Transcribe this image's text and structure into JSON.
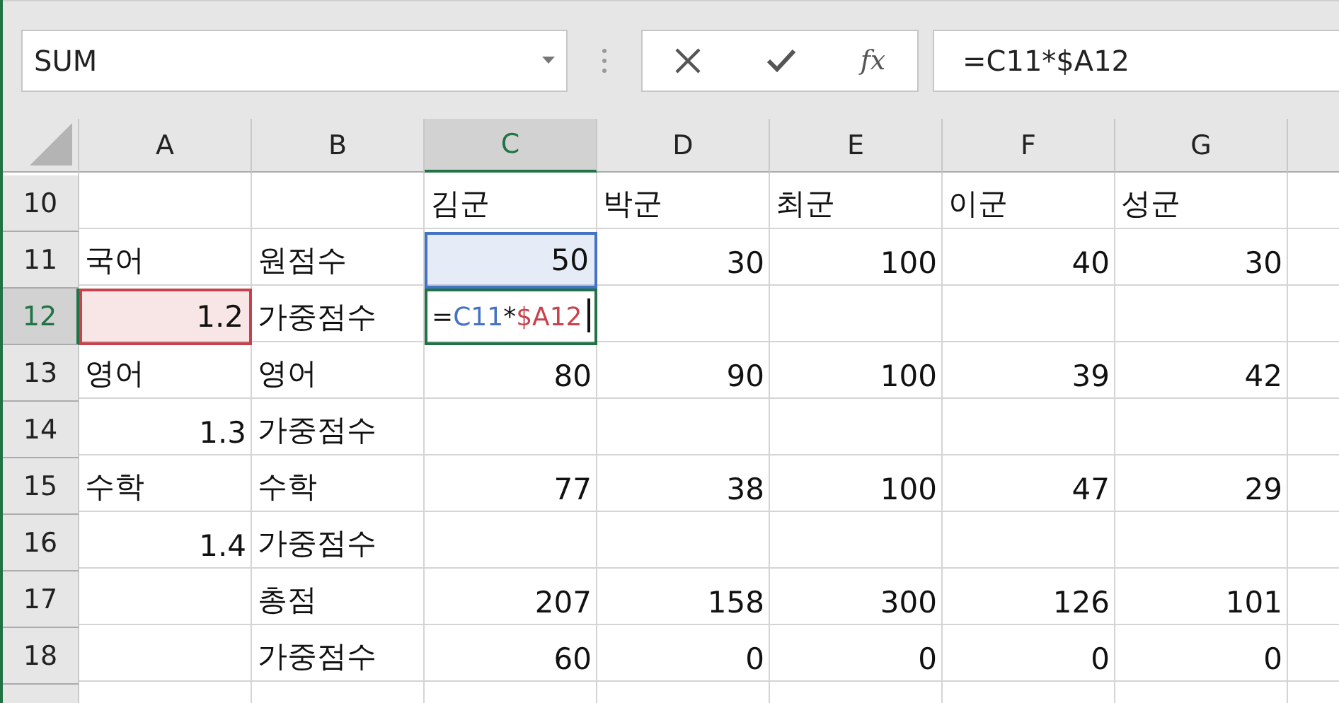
{
  "name_box": {
    "value": "SUM"
  },
  "formula_bar": {
    "function_label": "fx",
    "value": "=C11*$A12"
  },
  "columns": [
    {
      "label": "A",
      "selected": false
    },
    {
      "label": "B",
      "selected": false
    },
    {
      "label": "C",
      "selected": true
    },
    {
      "label": "D",
      "selected": false
    },
    {
      "label": "E",
      "selected": false
    },
    {
      "label": "F",
      "selected": false
    },
    {
      "label": "G",
      "selected": false
    }
  ],
  "rows": [
    {
      "label": "10",
      "selected": false,
      "cells": [
        null,
        null,
        {
          "text": "김군",
          "kind": "text"
        },
        {
          "text": "박군",
          "kind": "text"
        },
        {
          "text": "최군",
          "kind": "text"
        },
        {
          "text": "이군",
          "kind": "text"
        },
        {
          "text": "성군",
          "kind": "text"
        }
      ]
    },
    {
      "label": "11",
      "selected": false,
      "cells": [
        {
          "text": "국어",
          "kind": "text"
        },
        {
          "text": "원점수",
          "kind": "text"
        },
        {
          "text": "50",
          "kind": "number",
          "color": "#4472c4"
        },
        {
          "text": "30",
          "kind": "number"
        },
        {
          "text": "100",
          "kind": "number"
        },
        {
          "text": "40",
          "kind": "number"
        },
        {
          "text": "30",
          "kind": "number"
        }
      ]
    },
    {
      "label": "12",
      "selected": true,
      "cells": [
        {
          "text": "1.2",
          "kind": "number",
          "color": "#c8414b"
        },
        {
          "text": "가중점수",
          "kind": "text"
        },
        {
          "kind": "editing",
          "parts": [
            {
              "text": "="
            },
            {
              "text": "C11",
              "color": "#4472c4"
            },
            {
              "text": "*"
            },
            {
              "text": "$A12",
              "color": "#c8414b"
            }
          ]
        },
        null,
        null,
        null,
        null
      ]
    },
    {
      "label": "13",
      "selected": false,
      "cells": [
        {
          "text": "영어",
          "kind": "text"
        },
        {
          "text": "영어",
          "kind": "text"
        },
        {
          "text": "80",
          "kind": "number"
        },
        {
          "text": "90",
          "kind": "number"
        },
        {
          "text": "100",
          "kind": "number"
        },
        {
          "text": "39",
          "kind": "number"
        },
        {
          "text": "42",
          "kind": "number"
        }
      ]
    },
    {
      "label": "14",
      "selected": false,
      "cells": [
        {
          "text": "1.3",
          "kind": "number"
        },
        {
          "text": "가중점수",
          "kind": "text"
        },
        null,
        null,
        null,
        null,
        null
      ]
    },
    {
      "label": "15",
      "selected": false,
      "cells": [
        {
          "text": "수학",
          "kind": "text"
        },
        {
          "text": "수학",
          "kind": "text"
        },
        {
          "text": "77",
          "kind": "number"
        },
        {
          "text": "38",
          "kind": "number"
        },
        {
          "text": "100",
          "kind": "number"
        },
        {
          "text": "47",
          "kind": "number"
        },
        {
          "text": "29",
          "kind": "number"
        }
      ]
    },
    {
      "label": "16",
      "selected": false,
      "cells": [
        {
          "text": "1.4",
          "kind": "number"
        },
        {
          "text": "가중점수",
          "kind": "text"
        },
        null,
        null,
        null,
        null,
        null
      ]
    },
    {
      "label": "17",
      "selected": false,
      "cells": [
        null,
        {
          "text": "총점",
          "kind": "text"
        },
        {
          "text": "207",
          "kind": "number"
        },
        {
          "text": "158",
          "kind": "number"
        },
        {
          "text": "300",
          "kind": "number"
        },
        {
          "text": "126",
          "kind": "number"
        },
        {
          "text": "101",
          "kind": "number"
        }
      ]
    },
    {
      "label": "18",
      "selected": false,
      "cells": [
        null,
        {
          "text": "가중점수",
          "kind": "text"
        },
        {
          "text": "60",
          "kind": "number"
        },
        {
          "text": "0",
          "kind": "number"
        },
        {
          "text": "0",
          "kind": "number"
        },
        {
          "text": "0",
          "kind": "number"
        },
        {
          "text": "0",
          "kind": "number"
        }
      ]
    }
  ]
}
